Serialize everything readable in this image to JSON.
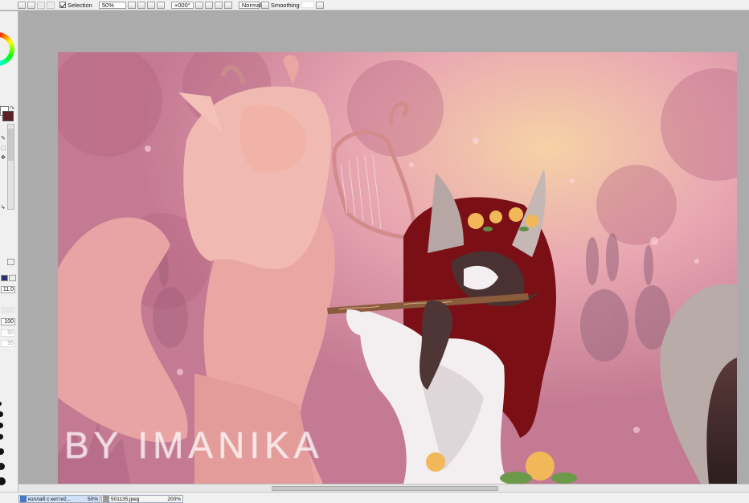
{
  "toolbar": {
    "selection_label": "Selection",
    "zoom_value": "50%",
    "rotation_value": "+000°",
    "blend_mode": "Normal",
    "smoothing_label": "Smoothing"
  },
  "left_panel": {
    "fg_color": "#5b1f24",
    "bg_color": "#ffffff",
    "size_value": "11.0",
    "density_value": "100",
    "option_value_1": "50",
    "option_value_2": "95"
  },
  "canvas": {
    "watermark": "BY IMANIKA",
    "palette": {
      "sky": "#d48ea4",
      "glow": "#f6cfa8",
      "left_character": "#e8a9a5",
      "hair_right": "#7a0f14",
      "fur_dark": "#4a3030",
      "fur_light": "#f3eff0",
      "flowers": "#f1b758",
      "leaves": "#5e8e45"
    }
  },
  "tabs": [
    {
      "name": "коллаб с кетти2...",
      "zoom": "50%"
    },
    {
      "name": "501135.jpeg",
      "zoom": "200%"
    }
  ]
}
